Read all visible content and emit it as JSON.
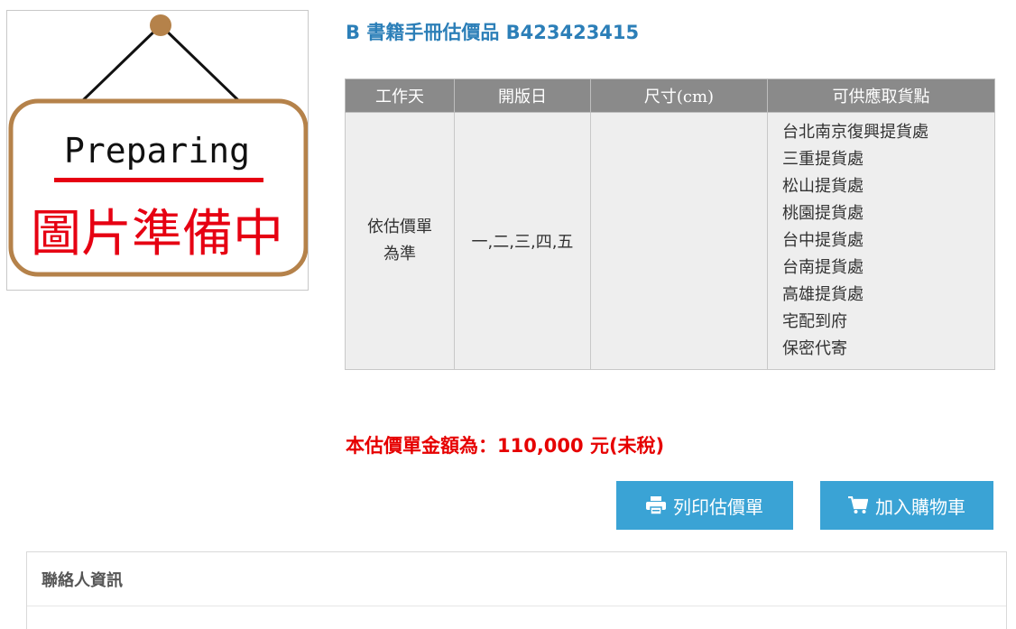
{
  "product": {
    "title": "B 書籍手冊估價品 B423423415",
    "image": {
      "alt_text_en": "Preparing",
      "alt_text_zh": "圖片準備中",
      "frame_color": "#b5824a",
      "accent_color": "#e60012"
    }
  },
  "spec_table": {
    "headers": [
      "工作天",
      "開版日",
      "尺寸(cm)",
      "可供應取貨點"
    ],
    "row": {
      "workdays_line1": "依估價單",
      "workdays_line2": "為準",
      "plate_days": "一,二,三,四,五",
      "size": "",
      "pickup_points": [
        "台北南京復興提貨處",
        "三重提貨處",
        "松山提貨處",
        "桃園提貨處",
        "台中提貨處",
        "台南提貨處",
        "高雄提貨處",
        "宅配到府",
        "保密代寄"
      ]
    }
  },
  "total": {
    "text": "本估價單金額為：110,000 元(未稅)"
  },
  "actions": {
    "print_label": "列印估價單",
    "print_icon": "printer-icon",
    "cart_label": "加入購物車",
    "cart_icon": "cart-icon"
  },
  "contact": {
    "heading": "聯絡人資訊"
  },
  "colors": {
    "title": "#2c7fb8",
    "total": "#e60000",
    "button": "#3aa3d5",
    "table_header": "#8a8a8a",
    "table_cell": "#eeeeee"
  }
}
